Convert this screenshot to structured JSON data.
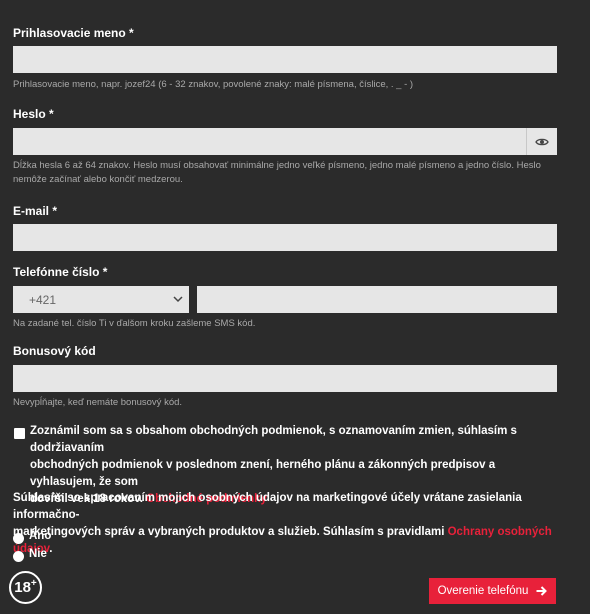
{
  "username": {
    "label": "Prihlasovacie meno *",
    "value": "",
    "hint": "Prihlasovacie meno, napr. jozef24 (6 - 32 znakov, povolené znaky: malé písmena, číslice, . _ - )"
  },
  "password": {
    "label": "Heslo *",
    "value": "",
    "hint_line1": "Dĺžka hesla 6 až 64 znakov. Heslo musí obsahovať minimálne jedno veľké písmeno, jedno malé písmeno a jedno číslo. Heslo",
    "hint_line2": "nemôže začínať alebo končiť medzerou."
  },
  "email": {
    "label": "E-mail *",
    "value": ""
  },
  "phone": {
    "label": "Telefónne číslo *",
    "prefix": "+421",
    "value": "",
    "hint": "Na zadané tel. číslo Ti v ďalšom kroku zašleme SMS kód."
  },
  "bonus": {
    "label": "Bonusový kód",
    "value": "",
    "hint": "Nevypĺňajte, keď nemáte bonusový kód."
  },
  "terms": {
    "line1": "Zoznámil som sa s obsahom obchodných podmienok, s oznamovaním zmien, súhlasím s dodržiavaním",
    "line2": "obchodných podmienok v poslednom znení, herného plánu a zákonných predpisov a vyhlasujem, že som",
    "line3": "dovŕšil vek 18 rokov.",
    "link": "Obchodné podmienky",
    "checked": false
  },
  "marketing": {
    "line1": "Súhlasím so spracovaním mojich osobných údajov na marketingové účely vrátane zasielania informačno-",
    "line2": "marketingových správ a vybraných produktov a služieb. Súhlasím s pravidlami",
    "link": "Ochrany osobných údajov",
    "suffix": ".",
    "options": [
      "Áno",
      "Nie"
    ]
  },
  "age_badge": {
    "number": "18",
    "plus": "+"
  },
  "verify_button": {
    "label": "Overenie telefónu"
  },
  "colors": {
    "background": "#2b2b2b",
    "accent": "#e8213a",
    "field": "#e6e6e6",
    "hint": "#a9a9a9"
  }
}
